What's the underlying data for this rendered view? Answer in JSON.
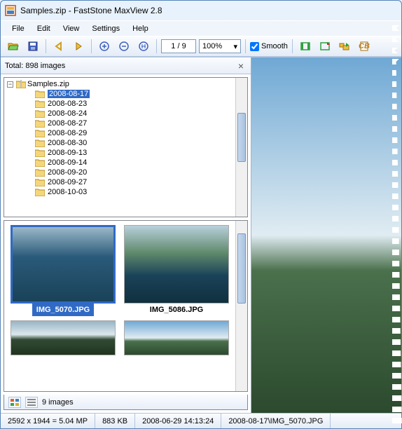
{
  "window": {
    "title": "Samples.zip - FastStone MaxView 2.8"
  },
  "menu": [
    "File",
    "Edit",
    "View",
    "Settings",
    "Help"
  ],
  "toolbar": {
    "page": "1 / 9",
    "zoom": "100%",
    "smooth_label": "Smooth",
    "smooth_checked": true
  },
  "panel": {
    "total_label": "Total: 898 images",
    "root": "Samples.zip",
    "folders": [
      "2008-08-17",
      "2008-08-23",
      "2008-08-24",
      "2008-08-27",
      "2008-08-29",
      "2008-08-30",
      "2008-09-13",
      "2008-09-14",
      "2008-09-20",
      "2008-09-27",
      "2008-10-03"
    ],
    "selected_folder_index": 0
  },
  "thumbs": {
    "items": [
      "IMG_5070.JPG",
      "IMG_5086.JPG"
    ],
    "selected_index": 0,
    "count_label": "9 images"
  },
  "status": {
    "dimensions": "2592 x 1944 = 5.04 MP",
    "filesize": "883 KB",
    "datetime": "2008-06-29 14:13:24",
    "path": "2008-08-17\\IMG_5070.JPG"
  },
  "colors": {
    "select": "#316ac5"
  }
}
